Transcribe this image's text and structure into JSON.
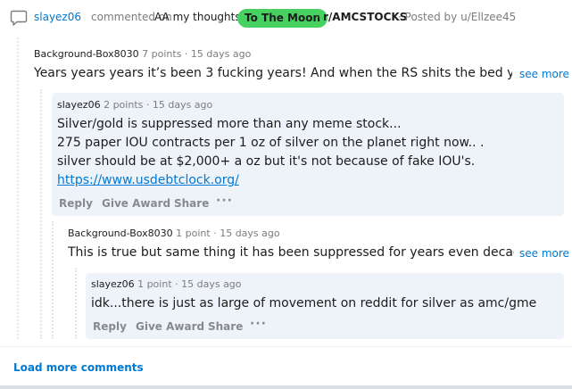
{
  "header": {
    "username": "slayez06",
    "commented_on": "commented on",
    "post_title": "AA my thoughts",
    "flair": "To The Moon",
    "separator": "·",
    "subreddit": "r/AMCSTOCKS",
    "posted_by": "· Posted by u/Ellzee45"
  },
  "comments": [
    {
      "author": "Background-Box8030",
      "meta": "7 points · 15 days ago",
      "body": "Years years years it’s been 3 fucking years! And when the RS shits the bed you still",
      "see_more": "see more"
    },
    {
      "author": "slayez06",
      "meta": "2 points · 15 days ago",
      "lines": [
        "Silver/gold is suppressed more than any meme stock...",
        "275 paper IOU contracts per 1 oz of silver on the planet right now.. .",
        "silver should be at $2,000+ a oz but it's not because of fake IOU's."
      ],
      "link": "https://www.usdebtclock.org/",
      "actions": {
        "reply": "Reply",
        "give_award": "Give Award",
        "share": "Share",
        "more": "···"
      }
    },
    {
      "author": "Background-Box8030",
      "meta": "1 point · 15 days ago",
      "body": "This is true but same thing it has been suppressed for years even decades. Do",
      "see_more": "see more"
    },
    {
      "author": "slayez06",
      "meta": "1 point · 15 days ago",
      "body": "idk...there is just as large of movement on reddit for silver as amc/gme",
      "actions": {
        "reply": "Reply",
        "give_award": "Give Award",
        "share": "Share",
        "more": "···"
      }
    }
  ],
  "load_more": "Load more comments",
  "colors": {
    "accent": "#0079d3",
    "flair": "#46d160",
    "highlight": "#eef3fa"
  }
}
